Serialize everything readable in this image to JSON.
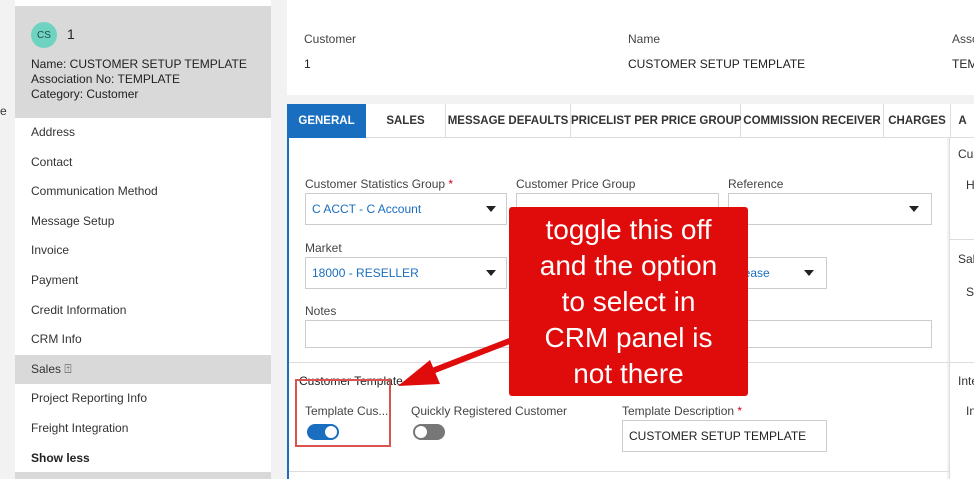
{
  "left_edge_text": "e",
  "sidebar": {
    "avatar": "CS",
    "id": "1",
    "name_line": "Name:  CUSTOMER SETUP TEMPLATE",
    "assoc_line": "Association No:  TEMPLATE",
    "category_line": "Category:  Customer",
    "items": [
      "Address",
      "Contact",
      "Communication Method",
      "Message Setup",
      "Invoice",
      "Payment",
      "Credit Information",
      "CRM Info",
      "Sales ⍐",
      "Project Reporting Info",
      "Freight Integration",
      "Show less"
    ]
  },
  "summary": {
    "customer_label": "Customer",
    "customer_value": "1",
    "name_label": "Name",
    "name_value": "CUSTOMER SETUP TEMPLATE",
    "assoc_label": "Asso",
    "assoc_value": "TEM"
  },
  "tabs": [
    "GENERAL",
    "SALES",
    "MESSAGE DEFAULTS",
    "PRICELIST PER PRICE GROUP",
    "COMMISSION RECEIVER",
    "CHARGES",
    "A"
  ],
  "form": {
    "stat_group_label": "Customer Statistics Group",
    "stat_group_value": "C ACCT - C Account",
    "price_group_label": "Customer Price Group",
    "reference_label": "Reference",
    "market_label": "Market",
    "market_value": "18000 - RESELLER",
    "hidden_select_value": "lease",
    "notes_label": "Notes",
    "required_mark": "*",
    "section_title": "Customer Template",
    "template_customer_label": "Template Cus...",
    "quick_reg_label": "Quickly Registered Customer",
    "template_desc_label": "Template Description",
    "template_desc_value": "CUSTOMER SETUP TEMPLATE"
  },
  "toggles": {
    "template_customer_on": true,
    "quickly_registered_on": false
  },
  "right_panel": {
    "t1": "Cus",
    "t2": "Hi",
    "t3": "Sal",
    "t4": "Sa",
    "t5": "Inte",
    "t6": "In"
  },
  "callout": {
    "line1": "toggle this off",
    "line2": "and the option",
    "line3": "to select in",
    "line4": "CRM panel is",
    "line5": "not there"
  },
  "colors": {
    "accent": "#1a6ec0",
    "callout": "#e00b0b",
    "avatar": "#6fd3c1",
    "highlight": "#d9534f"
  }
}
